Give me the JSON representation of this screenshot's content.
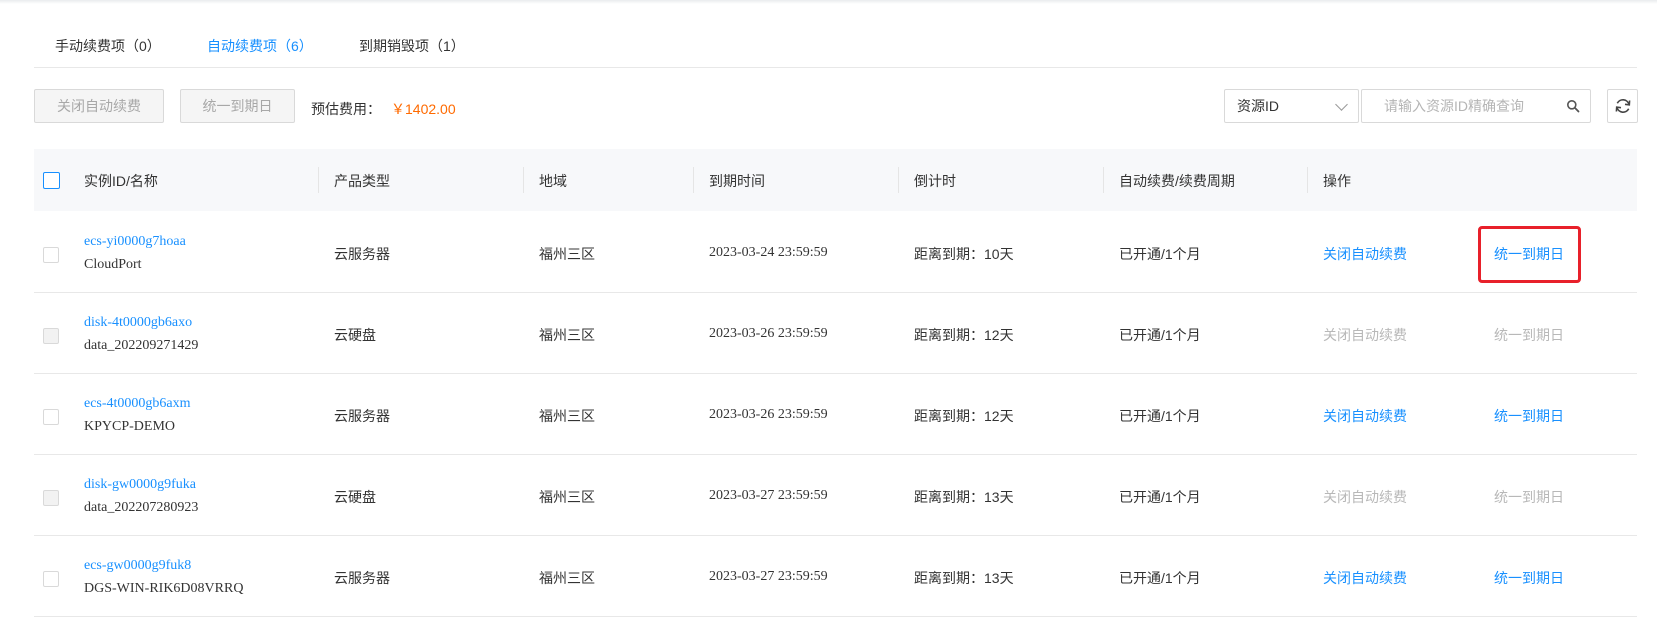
{
  "tabs": [
    {
      "label": "手动续费项（0）",
      "active": false
    },
    {
      "label": "自动续费项（6）",
      "active": true
    },
    {
      "label": "到期销毁项（1）",
      "active": false
    }
  ],
  "toolbar": {
    "close_auto_label": "关闭自动续费",
    "unify_label": "统一到期日",
    "fee_label": "预估费用：",
    "fee_value": "￥1402.00",
    "select_value": "资源ID",
    "search_placeholder": "请输入资源ID精确查询"
  },
  "table": {
    "headers": [
      "实例ID/名称",
      "产品类型",
      "地域",
      "到期时间",
      "倒计时",
      "自动续费/续费周期",
      "操作"
    ],
    "rows": [
      {
        "id": "ecs-yi0000g7hoaa",
        "name": "CloudPort",
        "type": "云服务器",
        "region": "福州三区",
        "expire": "2023-03-24 23:59:59",
        "countdown": "距离到期：10天",
        "renew": "已开通/1个月",
        "action1": "关闭自动续费",
        "action2": "统一到期日",
        "enabled": true
      },
      {
        "id": "disk-4t0000gb6axo",
        "name": "data_202209271429",
        "type": "云硬盘",
        "region": "福州三区",
        "expire": "2023-03-26 23:59:59",
        "countdown": "距离到期：12天",
        "renew": "已开通/1个月",
        "action1": "关闭自动续费",
        "action2": "统一到期日",
        "enabled": false
      },
      {
        "id": "ecs-4t0000gb6axm",
        "name": "KPYCP-DEMO",
        "type": "云服务器",
        "region": "福州三区",
        "expire": "2023-03-26 23:59:59",
        "countdown": "距离到期：12天",
        "renew": "已开通/1个月",
        "action1": "关闭自动续费",
        "action2": "统一到期日",
        "enabled": true
      },
      {
        "id": "disk-gw0000g9fuka",
        "name": "data_202207280923",
        "type": "云硬盘",
        "region": "福州三区",
        "expire": "2023-03-27 23:59:59",
        "countdown": "距离到期：13天",
        "renew": "已开通/1个月",
        "action1": "关闭自动续费",
        "action2": "统一到期日",
        "enabled": false
      },
      {
        "id": "ecs-gw0000g9fuk8",
        "name": "DGS-WIN-RIK6D08VRRQ",
        "type": "云服务器",
        "region": "福州三区",
        "expire": "2023-03-27 23:59:59",
        "countdown": "距离到期：13天",
        "renew": "已开通/1个月",
        "action1": "关闭自动续费",
        "action2": "统一到期日",
        "enabled": true
      }
    ]
  },
  "colors": {
    "link": "#1890ff",
    "fee": "#ff6a00",
    "highlight": "#e8202a",
    "disabled_text": "#b8b8b8"
  },
  "icons": [
    "search-icon",
    "refresh-icon",
    "chevron-down-icon"
  ]
}
